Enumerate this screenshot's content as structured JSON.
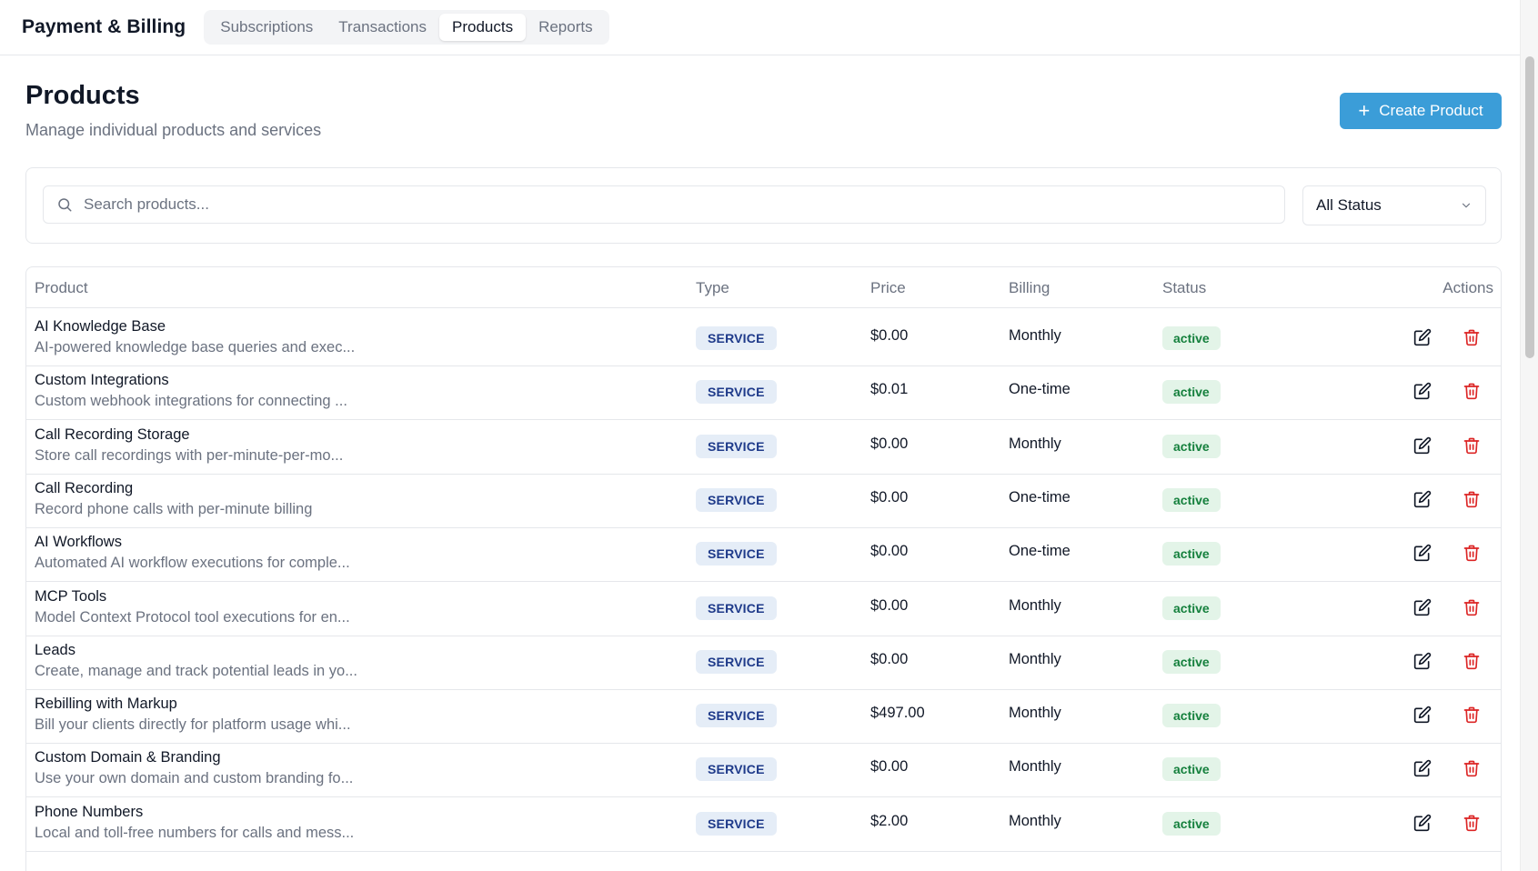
{
  "app": {
    "title": "Payment & Billing"
  },
  "tabs": [
    {
      "label": "Subscriptions",
      "active": false
    },
    {
      "label": "Transactions",
      "active": false
    },
    {
      "label": "Products",
      "active": true
    },
    {
      "label": "Reports",
      "active": false
    }
  ],
  "page": {
    "title": "Products",
    "subtitle": "Manage individual products and services",
    "create_label": "Create Product"
  },
  "filters": {
    "search_placeholder": "Search products...",
    "status_value": "All Status"
  },
  "table": {
    "columns": {
      "product": "Product",
      "type": "Type",
      "price": "Price",
      "billing": "Billing",
      "status": "Status",
      "actions": "Actions"
    },
    "rows": [
      {
        "name": "AI Knowledge Base",
        "description": "AI-powered knowledge base queries and exec...",
        "type": "SERVICE",
        "price": "$0.00",
        "billing": "Monthly",
        "status": "active"
      },
      {
        "name": "Custom Integrations",
        "description": "Custom webhook integrations for connecting ...",
        "type": "SERVICE",
        "price": "$0.01",
        "billing": "One-time",
        "status": "active"
      },
      {
        "name": "Call Recording Storage",
        "description": "Store call recordings with per-minute-per-mo...",
        "type": "SERVICE",
        "price": "$0.00",
        "billing": "Monthly",
        "status": "active"
      },
      {
        "name": "Call Recording",
        "description": "Record phone calls with per-minute billing",
        "type": "SERVICE",
        "price": "$0.00",
        "billing": "One-time",
        "status": "active"
      },
      {
        "name": "AI Workflows",
        "description": "Automated AI workflow executions for comple...",
        "type": "SERVICE",
        "price": "$0.00",
        "billing": "One-time",
        "status": "active"
      },
      {
        "name": "MCP Tools",
        "description": "Model Context Protocol tool executions for en...",
        "type": "SERVICE",
        "price": "$0.00",
        "billing": "Monthly",
        "status": "active"
      },
      {
        "name": "Leads",
        "description": "Create, manage and track potential leads in yo...",
        "type": "SERVICE",
        "price": "$0.00",
        "billing": "Monthly",
        "status": "active"
      },
      {
        "name": "Rebilling with Markup",
        "description": "Bill your clients directly for platform usage whi...",
        "type": "SERVICE",
        "price": "$497.00",
        "billing": "Monthly",
        "status": "active"
      },
      {
        "name": "Custom Domain & Branding",
        "description": "Use your own domain and custom branding fo...",
        "type": "SERVICE",
        "price": "$0.00",
        "billing": "Monthly",
        "status": "active"
      },
      {
        "name": "Phone Numbers",
        "description": "Local and toll-free numbers for calls and mess...",
        "type": "SERVICE",
        "price": "$2.00",
        "billing": "Monthly",
        "status": "active"
      }
    ]
  },
  "colors": {
    "accent": "#3b9dd8",
    "type_badge_bg": "#e5edf7",
    "type_badge_text": "#1e3a8a",
    "status_badge_bg": "#e3f4e8",
    "status_badge_text": "#15803d",
    "delete": "#dc2626"
  },
  "icons": {
    "search": "search-icon",
    "chevron": "chevron-down-icon",
    "plus": "plus-icon",
    "edit": "edit-icon",
    "delete": "trash-icon"
  }
}
